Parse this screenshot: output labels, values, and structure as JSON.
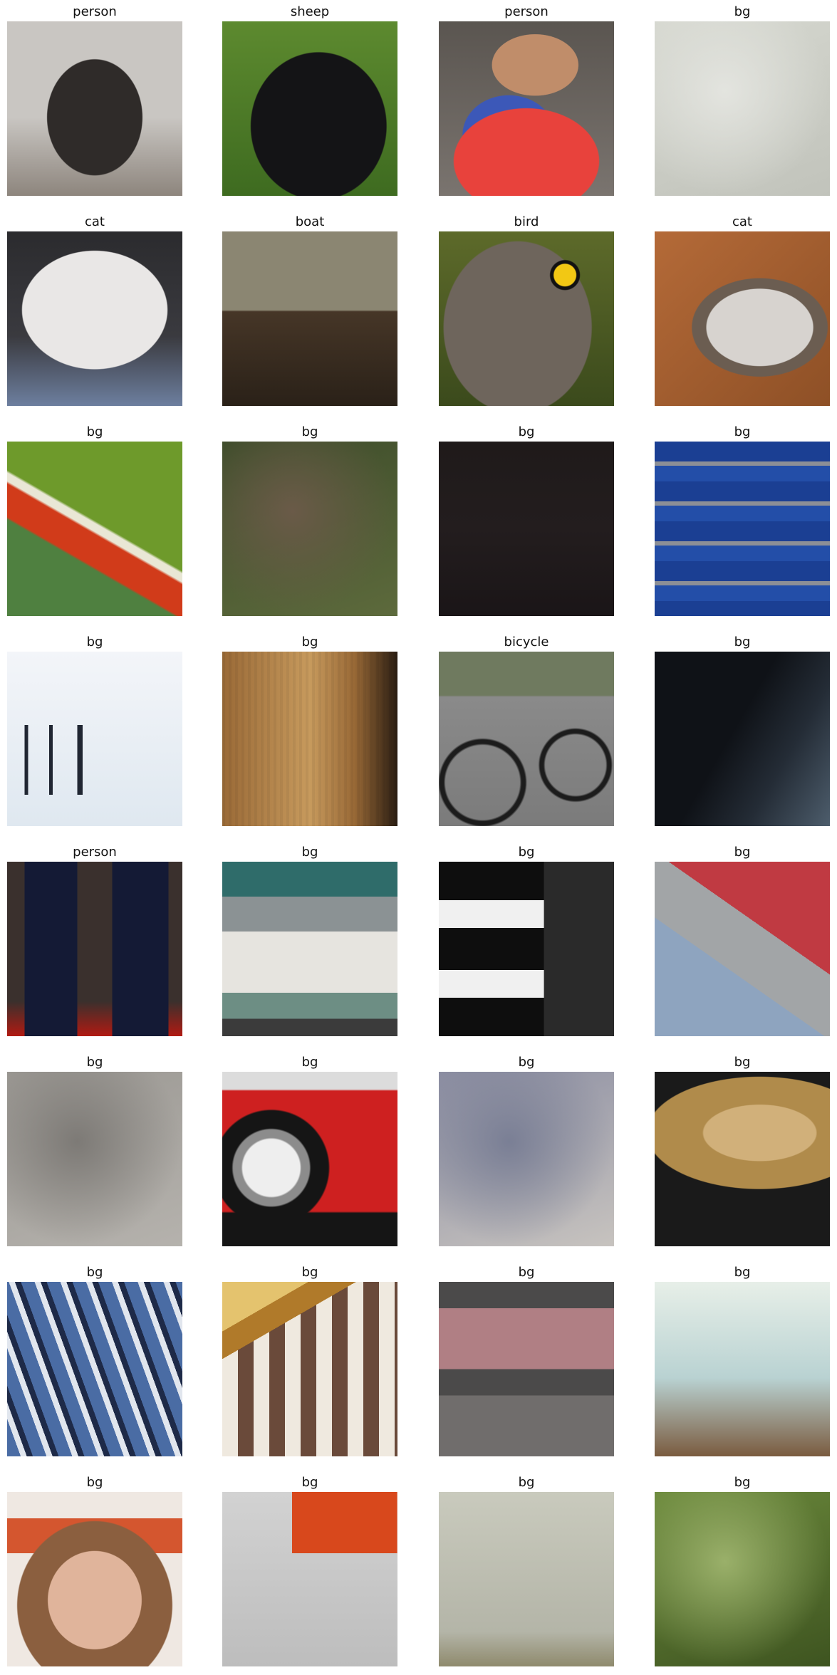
{
  "grid": {
    "columns": 4,
    "rows": 8,
    "items": [
      {
        "label": "person",
        "colors": [
          "#c9c6c2",
          "#8d857d",
          "#2f2b29"
        ],
        "style": "figure"
      },
      {
        "label": "sheep",
        "colors": [
          "#5d8a2f",
          "#3e6b20",
          "#141416"
        ],
        "style": "animal"
      },
      {
        "label": "person",
        "colors": [
          "#5a5550",
          "#e8423c",
          "#3c58b8"
        ],
        "style": "people"
      },
      {
        "label": "bg",
        "colors": [
          "#d6d8d0",
          "#c1c3bb",
          "#e3e4df"
        ],
        "style": "blur"
      },
      {
        "label": "cat",
        "colors": [
          "#6d7f9f",
          "#e9e7e6",
          "#3d3835"
        ],
        "style": "cat"
      },
      {
        "label": "boat",
        "colors": [
          "#8b8672",
          "#463627",
          "#2a2118"
        ],
        "style": "boat"
      },
      {
        "label": "bird",
        "colors": [
          "#5d6a2a",
          "#6e655c",
          "#f2c814"
        ],
        "style": "bird"
      },
      {
        "label": "cat",
        "colors": [
          "#b46a38",
          "#d7d3cf",
          "#6b5d51"
        ],
        "style": "cat2"
      },
      {
        "label": "bg",
        "colors": [
          "#4f8040",
          "#d13b1a",
          "#3a5b92"
        ],
        "style": "stripe"
      },
      {
        "label": "bg",
        "colors": [
          "#3d4c2a",
          "#5d6a3c",
          "#6a5a48"
        ],
        "style": "blur"
      },
      {
        "label": "bg",
        "colors": [
          "#1f1a1a",
          "#231d1e",
          "#1a1517"
        ],
        "style": "dark"
      },
      {
        "label": "bg",
        "colors": [
          "#1b3f93",
          "#234ea8",
          "#8c8f96"
        ],
        "style": "lines"
      },
      {
        "label": "bg",
        "colors": [
          "#f3f5f9",
          "#dfe8f0",
          "#202632"
        ],
        "style": "text"
      },
      {
        "label": "bg",
        "colors": [
          "#9a6a37",
          "#c79a5d",
          "#2a1d12"
        ],
        "style": "wood"
      },
      {
        "label": "bicycle",
        "colors": [
          "#6f7a5f",
          "#8a8a8a",
          "#1c1c1c"
        ],
        "style": "bike"
      },
      {
        "label": "bg",
        "colors": [
          "#0f1217",
          "#242c36",
          "#4d5d6c"
        ],
        "style": "dark2"
      },
      {
        "label": "person",
        "colors": [
          "#3a302d",
          "#141a35",
          "#b11a12"
        ],
        "style": "legs"
      },
      {
        "label": "bg",
        "colors": [
          "#2f6c6a",
          "#8b9294",
          "#6d8e84"
        ],
        "style": "houses"
      },
      {
        "label": "bg",
        "colors": [
          "#0e0e0e",
          "#f0f0f0",
          "#2a2a2a"
        ],
        "style": "bars"
      },
      {
        "label": "bg",
        "colors": [
          "#8ea4bf",
          "#a2a5a7",
          "#c03a42"
        ],
        "style": "plane"
      },
      {
        "label": "bg",
        "colors": [
          "#9b9893",
          "#b5b2ad",
          "#7d7a76"
        ],
        "style": "blur"
      },
      {
        "label": "bg",
        "colors": [
          "#ce2020",
          "#151515",
          "#dcdcdc"
        ],
        "style": "car"
      },
      {
        "label": "bg",
        "colors": [
          "#8c8ea2",
          "#c7c3bf",
          "#7a7f95"
        ],
        "style": "blur"
      },
      {
        "label": "bg",
        "colors": [
          "#b08b4b",
          "#d1b07a",
          "#ffffff"
        ],
        "style": "cymbal"
      },
      {
        "label": "bg",
        "colors": [
          "#5f8c3e",
          "#4a6ca4",
          "#1e2a48"
        ],
        "style": "helmet"
      },
      {
        "label": "bg",
        "colors": [
          "#b07a2a",
          "#e4c36e",
          "#6a4a3a"
        ],
        "style": "rail"
      },
      {
        "label": "bg",
        "colors": [
          "#4b4a4a",
          "#b07f84",
          "#706d6c"
        ],
        "style": "window"
      },
      {
        "label": "bg",
        "colors": [
          "#b9d2d2",
          "#7a5b3f",
          "#e7efe8"
        ],
        "style": "room"
      },
      {
        "label": "bg",
        "colors": [
          "#d4562f",
          "#8b5f3f",
          "#e0b49b"
        ],
        "style": "face"
      },
      {
        "label": "bg",
        "colors": [
          "#d2d2d2",
          "#d8481c",
          "#262626"
        ],
        "style": "office"
      },
      {
        "label": "bg",
        "colors": [
          "#c9cabd",
          "#b4b5a8",
          "#8f8a6d"
        ],
        "style": "fog"
      },
      {
        "label": "bg",
        "colors": [
          "#6c8a3c",
          "#3e5420",
          "#9ab06a"
        ],
        "style": "blur"
      }
    ]
  }
}
